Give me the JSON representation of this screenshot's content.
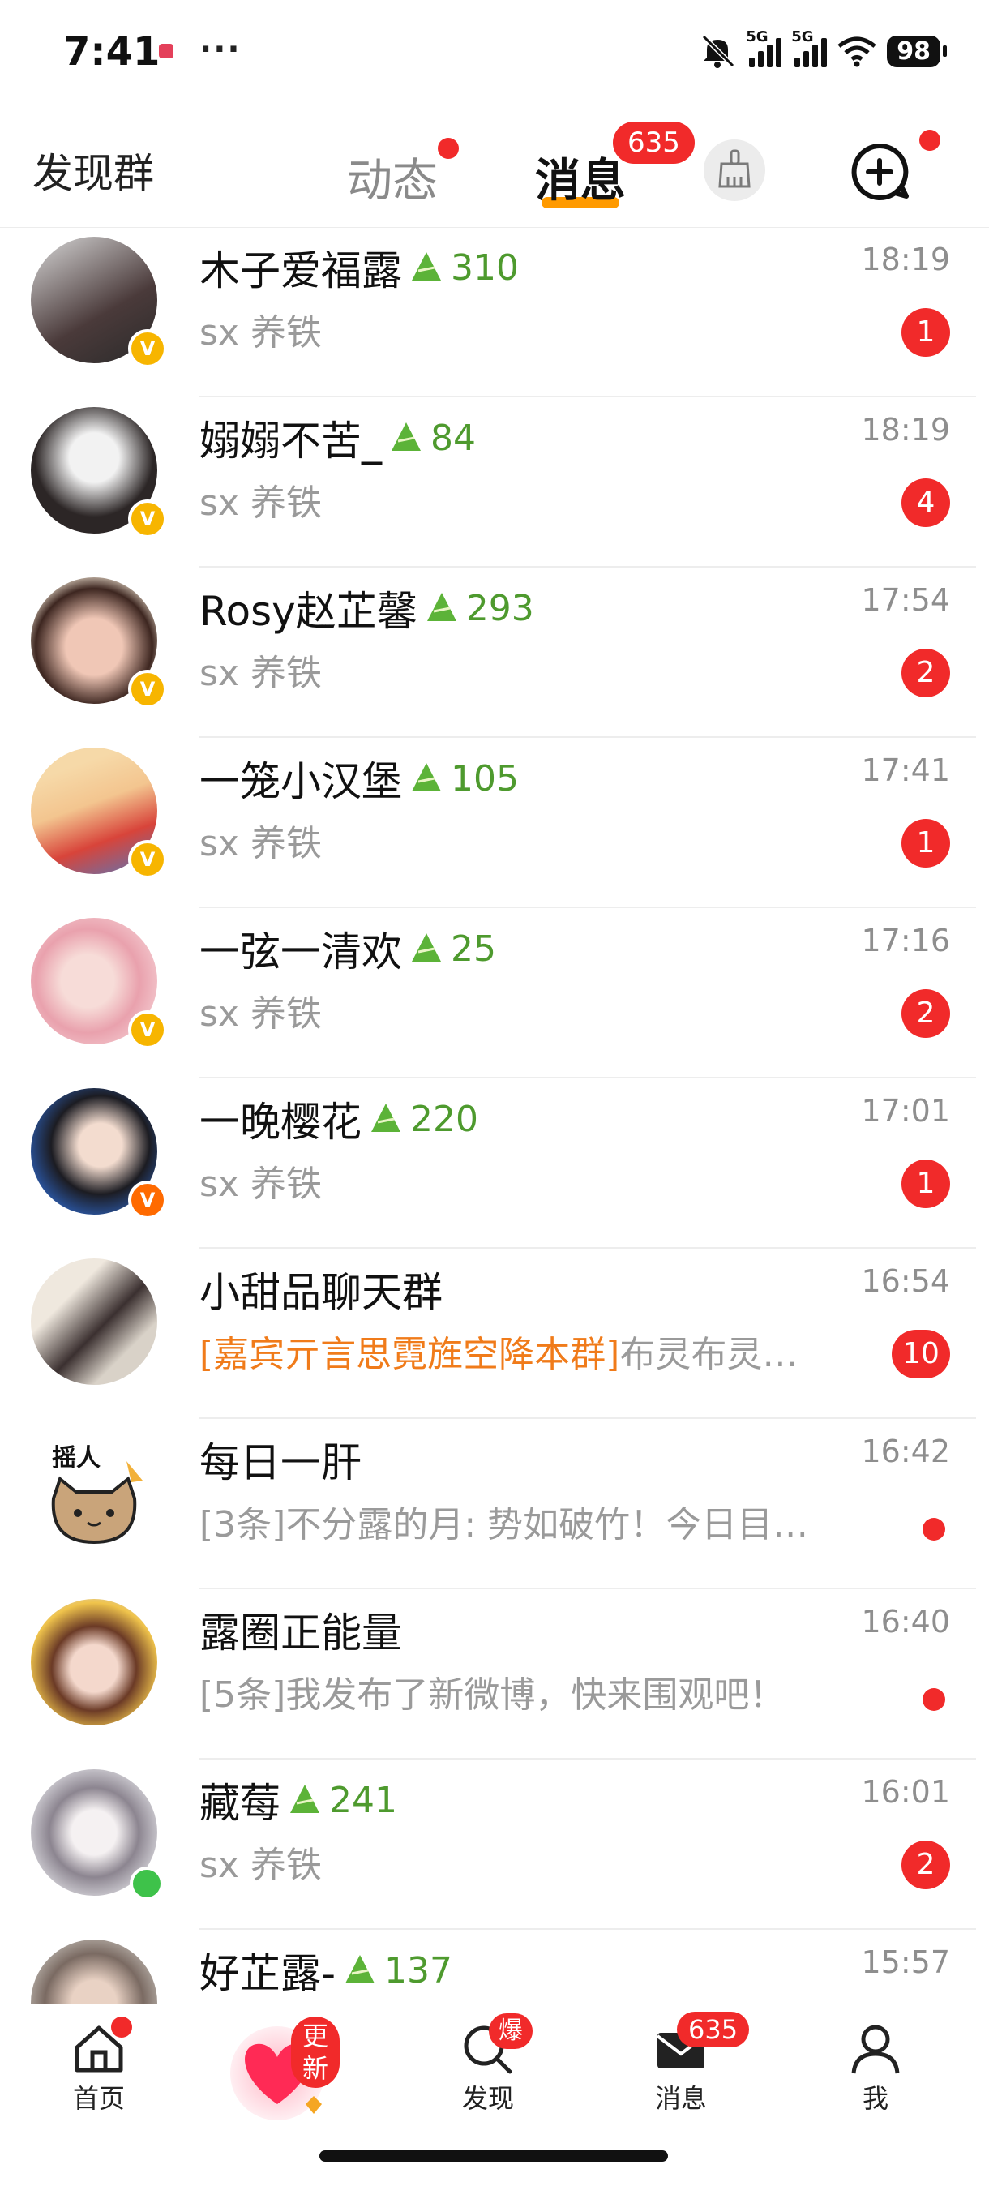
{
  "status_bar": {
    "time": "7:41",
    "dots": "···",
    "net1": "5G",
    "net2": "5G",
    "battery": "98"
  },
  "header": {
    "left_label": "发现群",
    "tabs": [
      {
        "label": "动态"
      },
      {
        "label": "消息",
        "badge": "635"
      }
    ]
  },
  "conversations": [
    {
      "name": "木子爱福露",
      "score": "310",
      "preview": "sx 养铁",
      "time": "18:19",
      "unread": "1",
      "badge": "v-yellow"
    },
    {
      "name": "嫋嫋不苦_",
      "score": "84",
      "preview": "sx 养铁",
      "time": "18:19",
      "unread": "4",
      "badge": "v-yellow"
    },
    {
      "name": "Rosy赵芷馨",
      "score": "293",
      "preview": "sx 养铁",
      "time": "17:54",
      "unread": "2",
      "badge": "v-yellow"
    },
    {
      "name": "一笼小汉堡",
      "score": "105",
      "preview": "sx 养铁",
      "time": "17:41",
      "unread": "1",
      "badge": "v-yellow"
    },
    {
      "name": "一弦一清欢",
      "score": "25",
      "preview": "sx 养铁",
      "time": "17:16",
      "unread": "2",
      "badge": "v-yellow"
    },
    {
      "name": "一晚樱花",
      "score": "220",
      "preview": "sx 养铁",
      "time": "17:01",
      "unread": "1",
      "badge": "v-orange"
    },
    {
      "name": "小甜品聊天群",
      "preview_highlight": "[嘉宾亓言思霓旌空降本群]",
      "preview": "布灵布灵…",
      "time": "16:54",
      "unread": "10"
    },
    {
      "name": "每日一肝",
      "preview": "[3条]不分露的月: 势如破竹！今日目…",
      "time": "16:42",
      "unread_dot": true
    },
    {
      "name": "露圈正能量",
      "preview": "[5条]我发布了新微博，快来围观吧！",
      "time": "16:40",
      "unread_dot": true
    },
    {
      "name": "藏莓",
      "score": "241",
      "preview": "sx 养铁",
      "time": "16:01",
      "unread": "2",
      "badge": "online"
    },
    {
      "name": "好芷露-",
      "score": "137",
      "preview": "",
      "time": "15:57"
    }
  ],
  "nav": {
    "home": "首页",
    "update_badge": "更新",
    "discover": "发现",
    "discover_badge": "爆",
    "messages": "消息",
    "messages_badge": "635",
    "me": "我"
  },
  "colors": {
    "accent_red": "#f12a2a",
    "tab_underline": "#ff9a00",
    "score_green": "#4e9a2e",
    "highlight_orange": "#f07b1a"
  }
}
